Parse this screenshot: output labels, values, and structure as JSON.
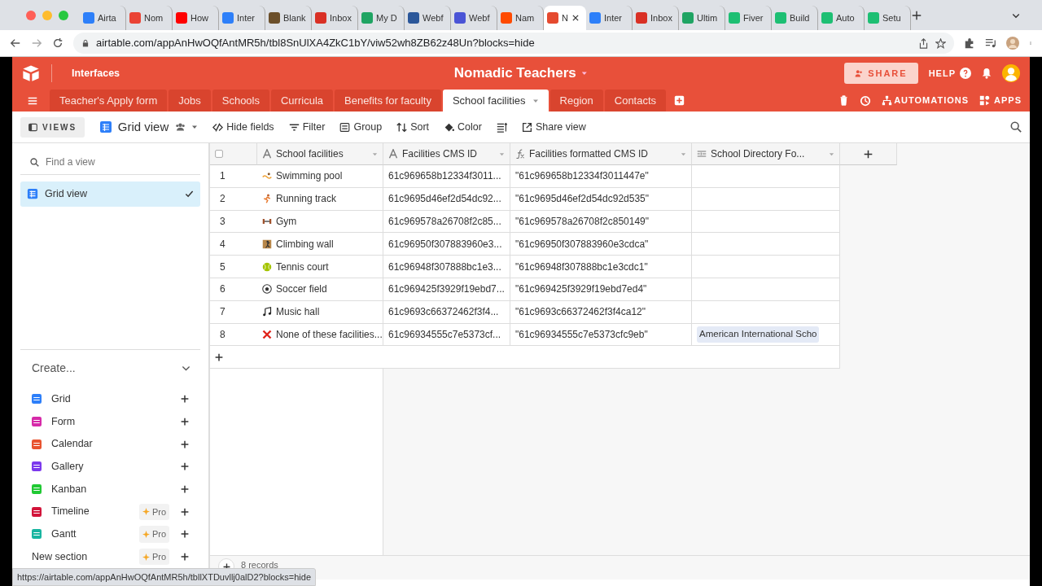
{
  "browser": {
    "tabs": [
      {
        "title": "Airta",
        "selected": false,
        "color": "#2d7ff9"
      },
      {
        "title": "Nom",
        "selected": false,
        "color": "#ea4335"
      },
      {
        "title": "How",
        "selected": false,
        "color": "#ff0000"
      },
      {
        "title": "Inter",
        "selected": false,
        "color": "#2d7ff9"
      },
      {
        "title": "Blank",
        "selected": false,
        "color": "#6b4f2a"
      },
      {
        "title": "Inbox",
        "selected": false,
        "color": "#d93025"
      },
      {
        "title": "My D",
        "selected": false,
        "color": "#1fa463"
      },
      {
        "title": "Webf",
        "selected": false,
        "color": "#2b579a"
      },
      {
        "title": "Webf",
        "selected": false,
        "color": "#4a54d6"
      },
      {
        "title": "Nam",
        "selected": false,
        "color": "#ff4a00"
      },
      {
        "title": "N",
        "selected": true,
        "color": "#e54a2f"
      },
      {
        "title": "Inter",
        "selected": false,
        "color": "#2d7ff9"
      },
      {
        "title": "Inbox",
        "selected": false,
        "color": "#d93025"
      },
      {
        "title": "Ultim",
        "selected": false,
        "color": "#1fa463"
      },
      {
        "title": "Fiver",
        "selected": false,
        "color": "#1dbf73"
      },
      {
        "title": "Build",
        "selected": false,
        "color": "#1dbf73"
      },
      {
        "title": "Auto",
        "selected": false,
        "color": "#1dbf73"
      },
      {
        "title": "Setu",
        "selected": false,
        "color": "#1dbf73"
      }
    ],
    "url": "airtable.com/appAnHwOQfAntMR5h/tbl8SnUlXA4ZkC1bY/viw52wh8ZB62z48Un?blocks=hide"
  },
  "app": {
    "interfaces": "Interfaces",
    "base_title": "Nomadic Teachers",
    "share": "SHARE",
    "help": "HELP",
    "automations": "AUTOMATIONS",
    "apps": "APPS"
  },
  "table_tabs": [
    {
      "label": "Teacher's Apply form",
      "selected": false
    },
    {
      "label": "Jobs",
      "selected": false
    },
    {
      "label": "Schools",
      "selected": false
    },
    {
      "label": "Curricula",
      "selected": false
    },
    {
      "label": "Benefits for faculty",
      "selected": false
    },
    {
      "label": "School facilities",
      "selected": true
    },
    {
      "label": "Region",
      "selected": false
    },
    {
      "label": "Contacts",
      "selected": false
    }
  ],
  "toolbar": {
    "views": "VIEWS",
    "view_name": "Grid view",
    "actions": [
      "Hide fields",
      "Filter",
      "Group",
      "Sort",
      "Color",
      "Share view"
    ]
  },
  "sidebar": {
    "search_placeholder": "Find a view",
    "views": [
      {
        "label": "Grid view",
        "selected": true
      }
    ],
    "create_heading": "Create...",
    "create_items": [
      {
        "label": "Grid",
        "color": "#2d7ff9",
        "kind": "view"
      },
      {
        "label": "Form",
        "color": "#d62aa8",
        "kind": "view"
      },
      {
        "label": "Calendar",
        "color": "#e8532f",
        "kind": "view"
      },
      {
        "label": "Gallery",
        "color": "#7c39ed",
        "kind": "view"
      },
      {
        "label": "Kanban",
        "color": "#20c933",
        "kind": "view"
      },
      {
        "label": "Timeline",
        "color": "#d2143a",
        "kind": "view",
        "badge": "Pro"
      },
      {
        "label": "Gantt",
        "color": "#18b5a0",
        "kind": "view",
        "badge": "Pro"
      },
      {
        "label": "New section",
        "kind": "section",
        "badge": "Pro"
      }
    ]
  },
  "grid": {
    "columns": [
      {
        "name": "School facilities"
      },
      {
        "name": "Facilities CMS ID"
      },
      {
        "name": "Facilities formatted CMS ID"
      },
      {
        "name": "School Directory Fo..."
      }
    ],
    "rows": [
      {
        "number": "1",
        "name": "Swimming pool",
        "cms_id": "61c969658b12334f3011...",
        "formatted_id": "\"61c969658b12334f3011447e\""
      },
      {
        "number": "2",
        "name": "Running track",
        "cms_id": "61c9695d46ef2d54dc92...",
        "formatted_id": "\"61c9695d46ef2d54dc92d535\""
      },
      {
        "number": "3",
        "name": "Gym",
        "cms_id": "61c969578a26708f2c85...",
        "formatted_id": "\"61c969578a26708f2c850149\""
      },
      {
        "number": "4",
        "name": "Climbing wall",
        "cms_id": "61c96950f307883960e3...",
        "formatted_id": "\"61c96950f307883960e3cdca\""
      },
      {
        "number": "5",
        "name": "Tennis court",
        "cms_id": "61c96948f307888bc1e3...",
        "formatted_id": "\"61c96948f307888bc1e3cdc1\""
      },
      {
        "number": "6",
        "name": "Soccer field",
        "cms_id": "61c969425f3929f19ebd7...",
        "formatted_id": "\"61c969425f3929f19ebd7ed4\""
      },
      {
        "number": "7",
        "name": "Music hall",
        "cms_id": "61c9693c66372462f3f4...",
        "formatted_id": "\"61c9693c66372462f3f4ca12\""
      },
      {
        "number": "8",
        "name": "None of these facilities...",
        "cms_id": "61c96934555c7e5373cf...",
        "formatted_id": "\"61c96934555c7e5373cfc9eb\"",
        "directory": "American International Scho"
      }
    ],
    "records": "8 records"
  },
  "status_url": "https://airtable.com/appAnHwOQfAntMR5h/tbllXTDuvllj0alD2?blocks=hide"
}
